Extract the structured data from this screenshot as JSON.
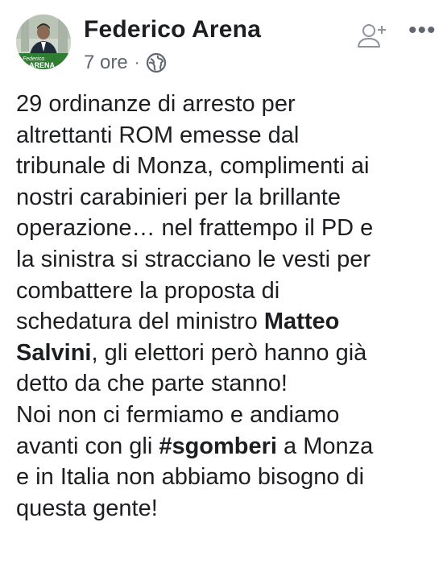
{
  "post": {
    "author": "Federico Arena",
    "time": "7 ore",
    "separator": "·",
    "privacy_icon": "globe-icon",
    "more_icon": "•••",
    "avatar_label_line1": "Federico",
    "avatar_label_line2": "ARENA",
    "lines": [
      {
        "text": "29 ordinanze di arresto per"
      },
      {
        "text": "altrettanti ROM emesse dal"
      },
      {
        "text": "tribunale di Monza, complimenti ai"
      },
      {
        "text": "nostri carabinieri per la brillante"
      },
      {
        "text": "operazione… nel frattempo il PD e"
      },
      {
        "text": "la sinistra si stracciano le vesti per"
      },
      {
        "text": "combattere la proposta di"
      },
      {
        "pre": "schedatura del ministro ",
        "bold": "Matteo"
      },
      {
        "bold": "Salvini",
        "post": ", gli elettori però hanno già"
      },
      {
        "text": "detto da che parte stanno!"
      },
      {
        "text": "Noi non ci fermiamo e andiamo"
      },
      {
        "pre": "avanti con gli ",
        "bold": "#sgomberi",
        "post": " a Monza"
      },
      {
        "text": "e in Italia non abbiamo bisogno di"
      },
      {
        "text": "questa gente!"
      }
    ]
  },
  "colors": {
    "text": "#1c1e21",
    "secondary": "#606770",
    "avatar_green": "#2e7d32"
  }
}
